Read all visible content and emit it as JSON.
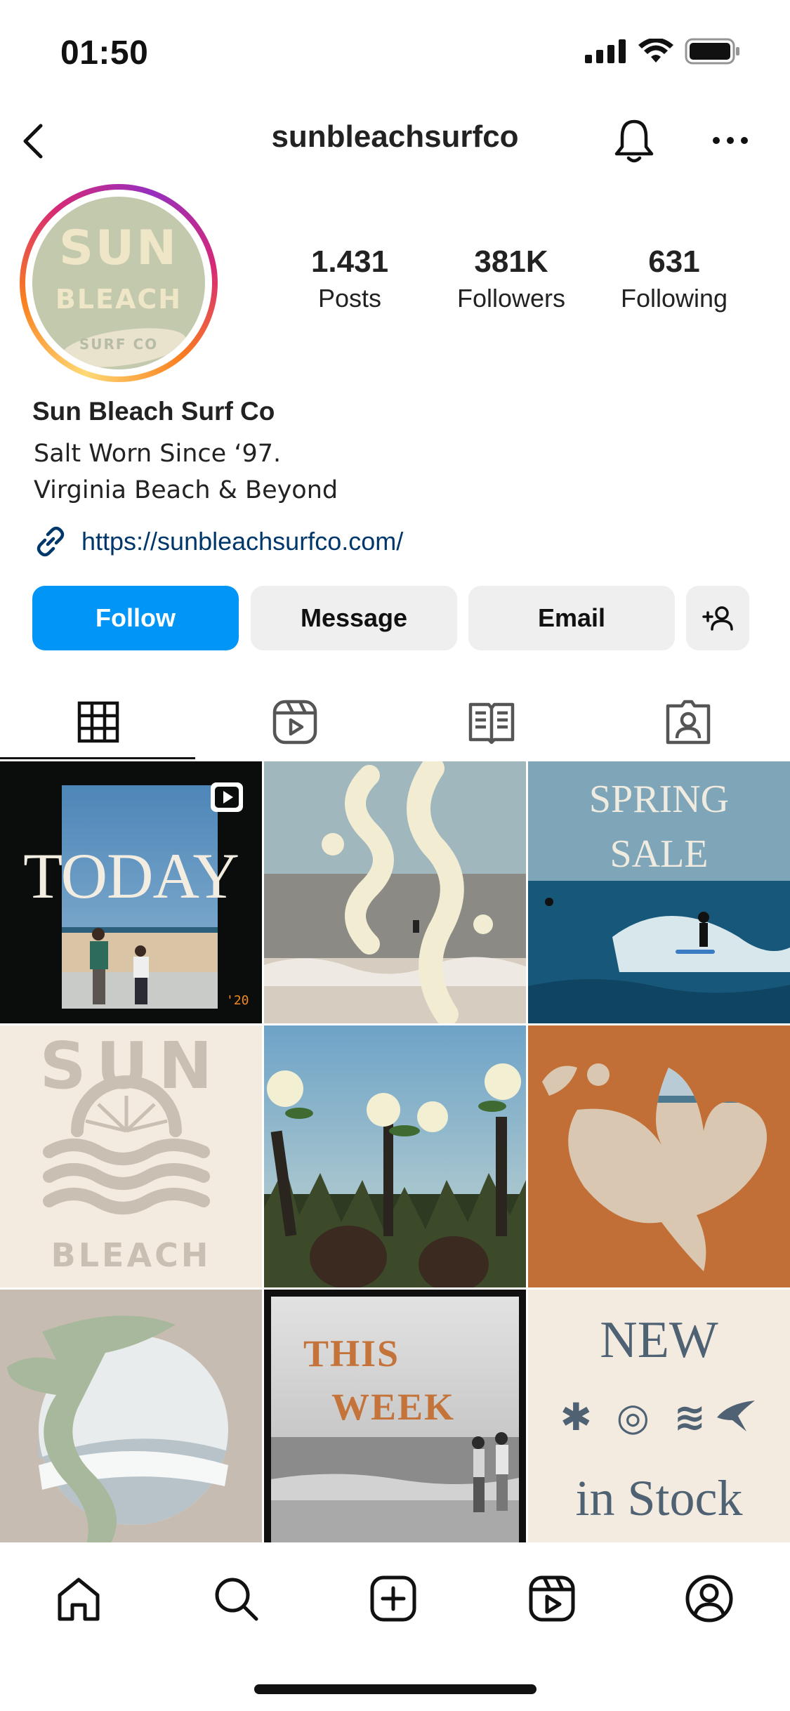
{
  "status": {
    "time": "01:50"
  },
  "header": {
    "username": "sunbleachsurfco",
    "back_icon": "chevron-left-icon",
    "bell_icon": "bell-icon",
    "more_icon": "more-horizontal-icon"
  },
  "profile": {
    "avatar_lines": [
      "SUN",
      "BLEACH",
      "SURF CO"
    ],
    "stats": [
      {
        "value": "1.431",
        "label": "Posts"
      },
      {
        "value": "381K",
        "label": "Followers"
      },
      {
        "value": "631",
        "label": "Following"
      }
    ],
    "display_name": "Sun Bleach Surf Co",
    "bio_lines": [
      "Salt Worn Since ‘97.",
      "Virginia Beach & Beyond"
    ],
    "link": "https://sunbleachsurfco.com/"
  },
  "actions": {
    "follow": "Follow",
    "message": "Message",
    "email": "Email",
    "add_user_icon": "add-user-icon"
  },
  "tabs": [
    {
      "icon": "grid-icon",
      "active": true
    },
    {
      "icon": "reels-icon",
      "active": false
    },
    {
      "icon": "guide-icon",
      "active": false
    },
    {
      "icon": "tagged-icon",
      "active": false
    }
  ],
  "posts": {
    "p1": {
      "text": "TODAY",
      "stamp": "'20"
    },
    "p3": {
      "line1": "SPRING",
      "line2": "SALE"
    },
    "p4": {
      "top": "SUN",
      "bottom": "BLEACH"
    },
    "p8": {
      "line1": "THIS",
      "line2": "WEEK"
    },
    "p9": {
      "line1": "NEW",
      "symbols": "✱ ◎ ≋",
      "line2": "in Stock"
    }
  },
  "colors": {
    "accent": "#0095f6",
    "link": "#00376b",
    "button_bg": "#efefef",
    "orange": "#c26f37",
    "sage": "#a8b89c"
  },
  "nav": [
    "home-icon",
    "search-icon",
    "create-icon",
    "reels-icon",
    "profile-icon"
  ]
}
